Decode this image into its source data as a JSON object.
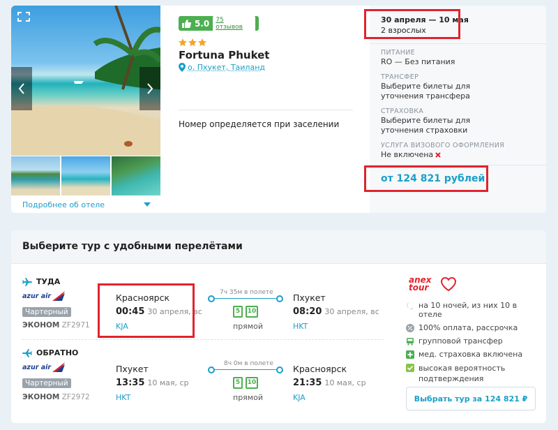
{
  "hotel": {
    "rating": "5.0",
    "reviews": "75 отзывов",
    "name": "Fortuna Phuket",
    "location": "о. Пхукет, Таиланд",
    "room": "Номер определяется при заселении",
    "more_link": "Подробнее об отеле",
    "stars": 3
  },
  "tour": {
    "dates": "30 апреля — 10 мая",
    "guests": "2 взрослых",
    "meal_label": "ПИТАНИЕ",
    "meal_value": "RO — Без питания",
    "transfer_label": "ТРАНСФЕР",
    "transfer_value": "Выберите билеты для уточнения трансфера",
    "insurance_label": "СТРАХОВКА",
    "insurance_value": "Выберите билеты для уточнения страховки",
    "visa_label": "УСЛУГА ВИЗОВОГО ОФОРМЛЕНИЯ",
    "visa_value": "Не включена",
    "price": "от 124 821 рублей"
  },
  "flights": {
    "section_title": "Выберите тур с удобными перелётами",
    "outbound": {
      "label": "ТУДА",
      "airline": "azur air",
      "type": "Чартерный",
      "class": "ЭКОНОМ",
      "flight_no": "ZF2971",
      "from_city": "Красноярск",
      "from_time": "00:45",
      "from_date": "30 апреля, вс",
      "from_code": "KJA",
      "duration": "7ч 35м в полете",
      "direct": "прямой",
      "to_city": "Пхукет",
      "to_time": "08:20",
      "to_date": "30 апреля, вс",
      "to_code": "HKT",
      "bag1": "5",
      "bag2": "10"
    },
    "return": {
      "label": "ОБРАТНО",
      "airline": "azur air",
      "type": "Чартерный",
      "class": "ЭКОНОМ",
      "flight_no": "ZF2972",
      "from_city": "Пхукет",
      "from_time": "13:35",
      "from_date": "10 мая, ср",
      "from_code": "HKT",
      "duration": "8ч 0м в полете",
      "direct": "прямой",
      "to_city": "Красноярск",
      "to_time": "21:35",
      "to_date": "10 мая, ср",
      "to_code": "KJA",
      "bag1": "5",
      "bag2": "10"
    }
  },
  "operator": {
    "name": "anex tour",
    "features": [
      "на 10 ночей, из них 10 в отеле",
      "100% оплата, рассрочка",
      "групповой трансфер",
      "мед. страховка включена",
      "высокая вероятность подтверждения"
    ],
    "button": "Выбрать тур за 124 821 ₽"
  },
  "colors": {
    "accent": "#1a9fc9",
    "green": "#4caf50",
    "red_highlight": "#e0232e"
  }
}
